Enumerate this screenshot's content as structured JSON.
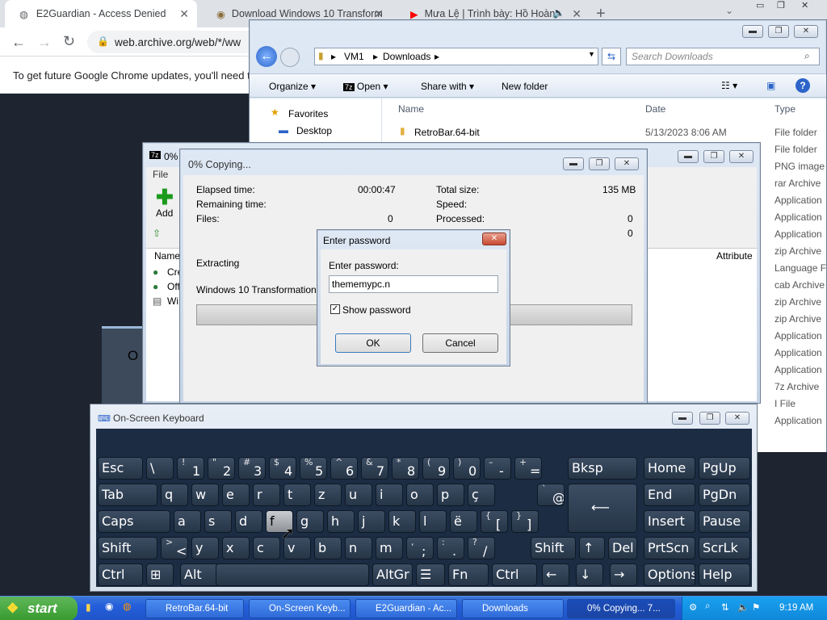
{
  "browser": {
    "tabs": [
      {
        "title": "E2Guardian - Access Denied"
      },
      {
        "title": "Download Windows 10 Transform"
      },
      {
        "title": "Mưa Lệ | Trình bày: Hồ Hoàn"
      }
    ],
    "url": "web.archive.org/web/*/ww",
    "info_bar": "To get future Google Chrome updates, you'll need t"
  },
  "explorer": {
    "breadcrumb": [
      "VM1",
      "Downloads"
    ],
    "search_placeholder": "Search Downloads",
    "toolbar": [
      "Organize",
      "Open",
      "Share with",
      "New folder"
    ],
    "columns": {
      "name": "Name",
      "date": "Date",
      "type": "Type"
    },
    "nav": {
      "favorites": "Favorites",
      "desktop": "Desktop"
    },
    "row": {
      "name": "RetroBar.64-bit",
      "date": "5/13/2023 8:06 AM"
    },
    "types": [
      "File folder",
      "File folder",
      "PNG image",
      "rar Archive",
      "Application",
      "Application",
      "Application",
      "zip Archive",
      "Language F",
      "cab Archive",
      "zip Archive",
      "zip Archive",
      "Application",
      "Application",
      "Application",
      "7z Archive",
      "I File",
      "Application"
    ]
  },
  "sevenzip": {
    "title": "0%",
    "menu_file": "File",
    "add_label": "Add",
    "col_name": "Name",
    "col_attrib": "Attribute",
    "items": [
      "Cre",
      "Off",
      "Wi"
    ]
  },
  "copying": {
    "title": "0% Copying...",
    "elapsed_label": "Elapsed time:",
    "elapsed_value": "00:00:47",
    "remaining_label": "Remaining time:",
    "files_label": "Files:",
    "files_value": "0",
    "total_label": "Total size:",
    "total_value": "135 MB",
    "speed_label": "Speed:",
    "processed_label": "Processed:",
    "processed_value": "0",
    "extra_value": "0",
    "extracting": "Extracting",
    "filename": "Windows 10 Transformation Pac"
  },
  "password": {
    "title": "Enter password",
    "label": "Enter password:",
    "value": "thememypc.n",
    "show_label": "Show password",
    "ok": "OK",
    "cancel": "Cancel"
  },
  "osk": {
    "title": "On-Screen Keyboard",
    "behind_text": "O"
  },
  "keyboard": {
    "row1": [
      "Esc",
      "\\",
      "1",
      "2",
      "3",
      "4",
      "5",
      "6",
      "7",
      "8",
      "9",
      "0",
      "-",
      "=",
      "Bksp",
      "Home",
      "PgUp"
    ],
    "row1_shift": [
      "",
      "",
      "!",
      "\"",
      "#",
      "$",
      "%",
      "^",
      "&",
      "*",
      "(",
      ")",
      "–",
      "+"
    ],
    "row2": [
      "Tab",
      "q",
      "w",
      "e",
      "r",
      "t",
      "z",
      "u",
      "i",
      "o",
      "p",
      "ç",
      "@",
      "End",
      "PgDn"
    ],
    "row3": [
      "Caps",
      "a",
      "s",
      "d",
      "f",
      "g",
      "h",
      "j",
      "k",
      "l",
      "ë",
      "[",
      "]",
      "Insert",
      "Pause"
    ],
    "row4": [
      "Shift",
      "<",
      "y",
      "x",
      "c",
      "v",
      "b",
      "n",
      "m",
      ";",
      ".",
      "/",
      "Shift",
      "↑",
      "Del",
      "PrtScn",
      "ScrLk"
    ],
    "row4_shift": [
      "",
      ">",
      "",
      "",
      "",
      "",
      "",
      "",
      "",
      ",",
      ":",
      "?"
    ],
    "row5": [
      "Ctrl",
      "⊞",
      "Alt",
      "",
      "AltGr",
      "☰",
      "Fn",
      "Ctrl",
      "←",
      "↓",
      "→",
      "Options",
      "Help"
    ]
  },
  "taskbar": {
    "start": "start",
    "buttons": [
      "RetroBar.64-bit",
      "On-Screen Keyb...",
      "E2Guardian - Ac...",
      "Downloads",
      "0% Copying... 7..."
    ],
    "clock": "9:19 AM"
  },
  "colors": {
    "accent": "#245edb",
    "start_green": "#379a2e"
  }
}
